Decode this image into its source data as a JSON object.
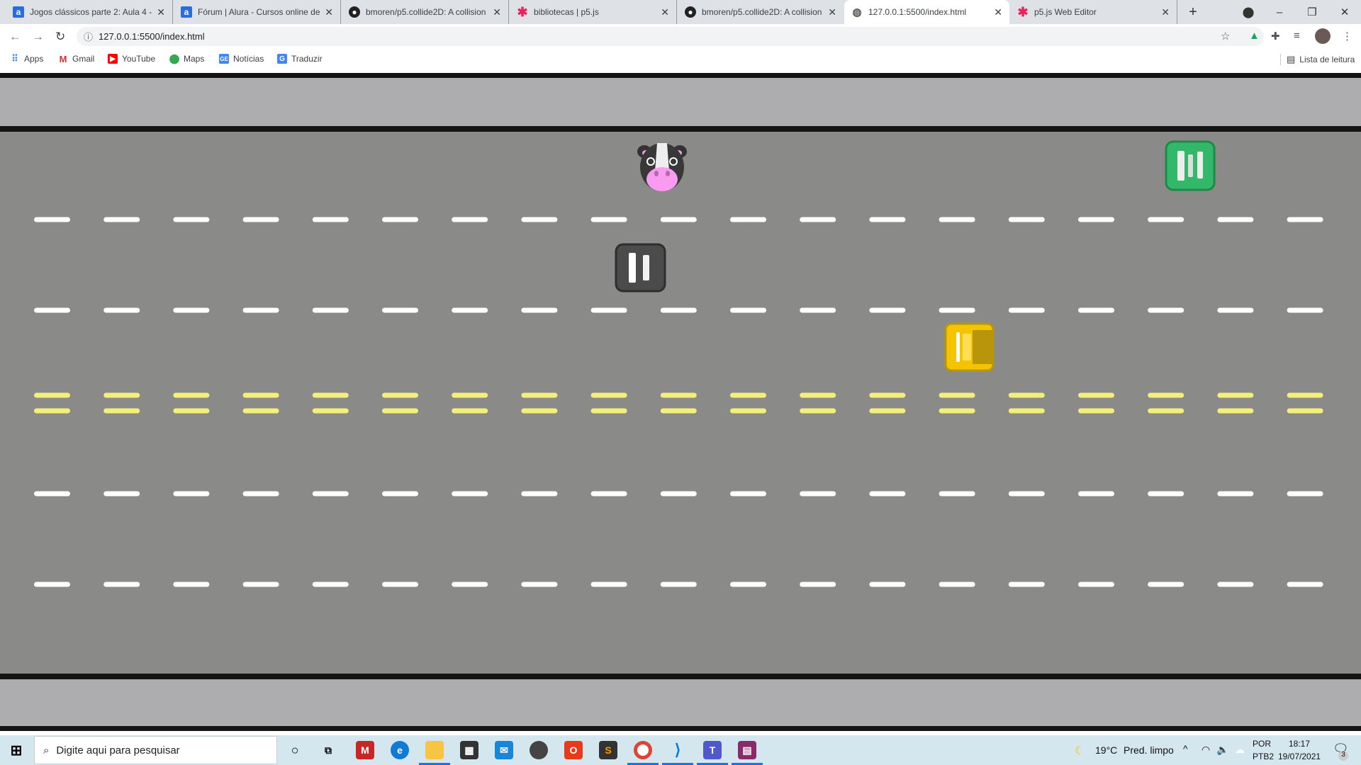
{
  "browser": {
    "tabs": [
      {
        "title": "Jogos clássicos parte 2: Aula 4 -",
        "icon": "alura-icon",
        "active": false
      },
      {
        "title": "Fórum | Alura - Cursos online de",
        "icon": "alura-icon",
        "active": false
      },
      {
        "title": "bmoren/p5.collide2D: A collision",
        "icon": "github-icon",
        "active": false
      },
      {
        "title": "bibliotecas | p5.js",
        "icon": "p5-asterisk-icon",
        "active": false
      },
      {
        "title": "bmoren/p5.collide2D: A collision",
        "icon": "github-icon",
        "active": false
      },
      {
        "title": "127.0.0.1:5500/index.html",
        "icon": "globe-icon",
        "active": true
      },
      {
        "title": "p5.js Web Editor",
        "icon": "p5-asterisk-icon",
        "active": false
      }
    ],
    "url": "127.0.0.1:5500/index.html",
    "bookmarks": [
      {
        "label": "Apps",
        "icon": "apps-grid-icon"
      },
      {
        "label": "Gmail",
        "icon": "gmail-icon"
      },
      {
        "label": "YouTube",
        "icon": "youtube-icon"
      },
      {
        "label": "Maps",
        "icon": "maps-pin-icon"
      },
      {
        "label": "Notícias",
        "icon": "news-icon"
      },
      {
        "label": "Traduzir",
        "icon": "translate-icon"
      }
    ],
    "reading_list": "Lista de leitura"
  },
  "game": {
    "colors": {
      "road": "#8a8b89",
      "sidewalk": "#adacae",
      "border": "#141414",
      "white_line": "#ffffff",
      "yellow_line": "#f3ef7a"
    },
    "sprites": [
      {
        "name": "cow-player",
        "color": "#ff9cf3"
      },
      {
        "name": "car-gray",
        "color": "#4d4d4d"
      },
      {
        "name": "car-green",
        "color": "#33b86a"
      },
      {
        "name": "car-yellow",
        "color": "#f5c400"
      }
    ]
  },
  "taskbar": {
    "search_placeholder": "Digite aqui para pesquisar",
    "weather_temp": "19°C",
    "weather_text": "Pred. limpo",
    "lang_top": "POR",
    "lang_bottom": "PTB2",
    "time": "18:17",
    "date": "19/07/2021",
    "notifications": "3"
  }
}
